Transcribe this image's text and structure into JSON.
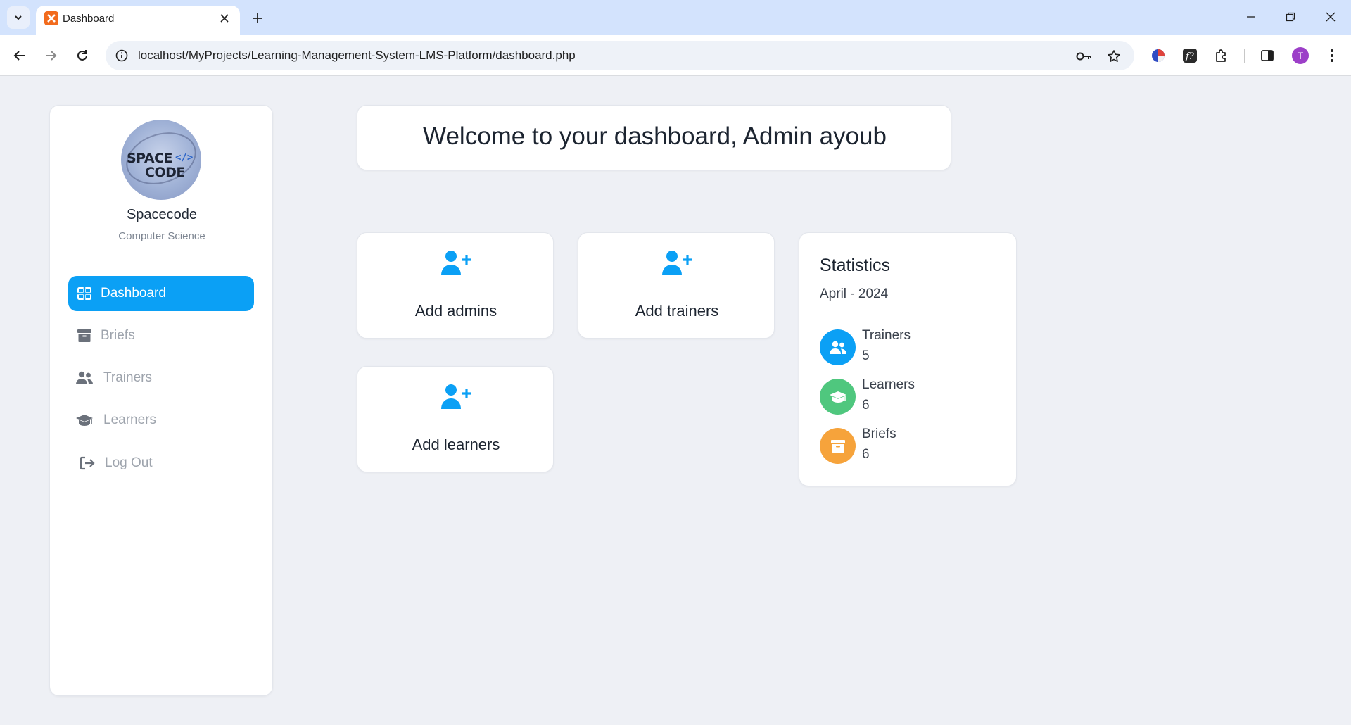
{
  "browser": {
    "tab_title": "Dashboard",
    "url": "localhost/MyProjects/Learning-Management-System-LMS-Platform/dashboard.php",
    "profile_initial": "T"
  },
  "sidebar": {
    "org_name": "Spacecode",
    "org_subtitle": "Computer Science",
    "logo_text_1": "SPACE",
    "logo_text_2": "CODE",
    "logo_code": "</>",
    "items": [
      {
        "label": "Dashboard",
        "icon": "grid-icon",
        "active": true
      },
      {
        "label": "Briefs",
        "icon": "archive-box-icon",
        "active": false
      },
      {
        "label": "Trainers",
        "icon": "users-icon",
        "active": false
      },
      {
        "label": "Learners",
        "icon": "graduation-cap-icon",
        "active": false
      },
      {
        "label": "Log Out",
        "icon": "logout-icon",
        "active": false
      }
    ]
  },
  "main": {
    "welcome": "Welcome to your dashboard, Admin ayoub",
    "cards": [
      {
        "label": "Add admins",
        "icon": "user-plus-icon"
      },
      {
        "label": "Add trainers",
        "icon": "user-plus-icon"
      },
      {
        "label": "Add learners",
        "icon": "user-plus-icon"
      }
    ]
  },
  "statistics": {
    "title": "Statistics",
    "period": "April - 2024",
    "items": [
      {
        "label": "Trainers",
        "value": "5",
        "color": "#0ba0f5",
        "icon": "users-icon"
      },
      {
        "label": "Learners",
        "value": "6",
        "color": "#4fc77e",
        "icon": "graduation-cap-icon"
      },
      {
        "label": "Briefs",
        "value": "6",
        "color": "#f6a33b",
        "icon": "archive-box-icon"
      }
    ]
  },
  "colors": {
    "accent": "#0ba0f5",
    "page_bg": "#eef0f5",
    "learners": "#4fc77e",
    "briefs": "#f6a33b"
  }
}
